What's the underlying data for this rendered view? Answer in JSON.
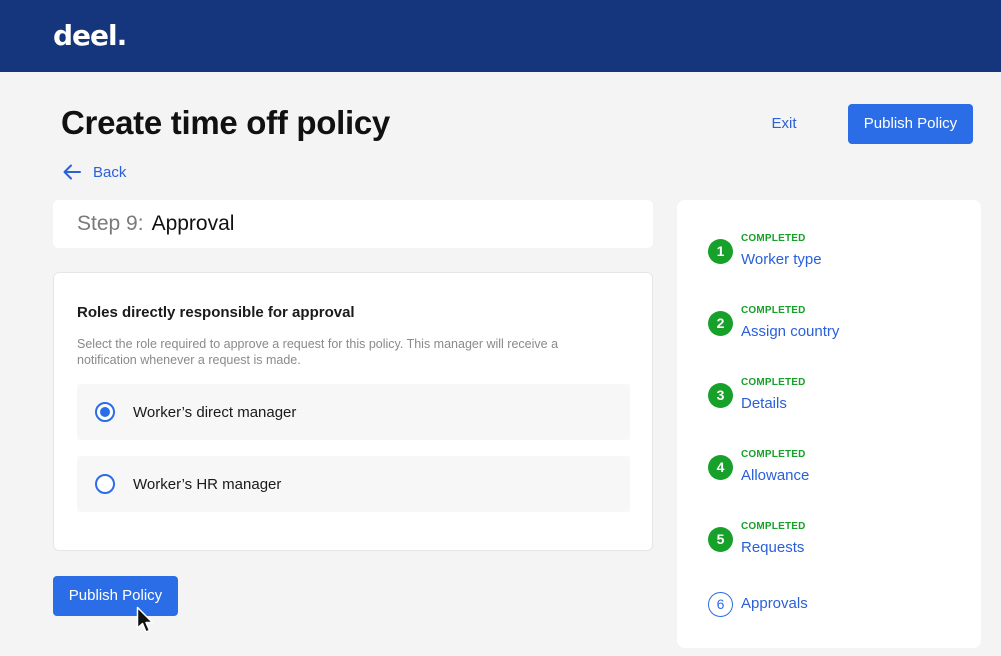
{
  "header": {
    "logo": "deel."
  },
  "page": {
    "title": "Create time off policy",
    "exit_label": "Exit",
    "publish_label": "Publish Policy",
    "back_label": "Back"
  },
  "step": {
    "prefix": "Step 9:",
    "name": "Approval"
  },
  "approval": {
    "title": "Roles directly responsible for approval",
    "description": "Select the role required to approve a request for this policy. This manager will receive a notification whenever a request is made.",
    "options": [
      {
        "label": "Worker’s direct manager",
        "selected": true
      },
      {
        "label": "Worker’s HR manager",
        "selected": false
      }
    ]
  },
  "footer": {
    "publish_label": "Publish Policy"
  },
  "steps": [
    {
      "number": "1",
      "status": "COMPLETED",
      "label": "Worker type"
    },
    {
      "number": "2",
      "status": "COMPLETED",
      "label": "Assign country"
    },
    {
      "number": "3",
      "status": "COMPLETED",
      "label": "Details"
    },
    {
      "number": "4",
      "status": "COMPLETED",
      "label": "Allowance"
    },
    {
      "number": "5",
      "status": "COMPLETED",
      "label": "Requests"
    },
    {
      "number": "6",
      "status": "",
      "label": "Approvals"
    }
  ],
  "colors": {
    "topbar": "#15357c",
    "primary": "#2b6de6",
    "completed": "#17a02a"
  }
}
